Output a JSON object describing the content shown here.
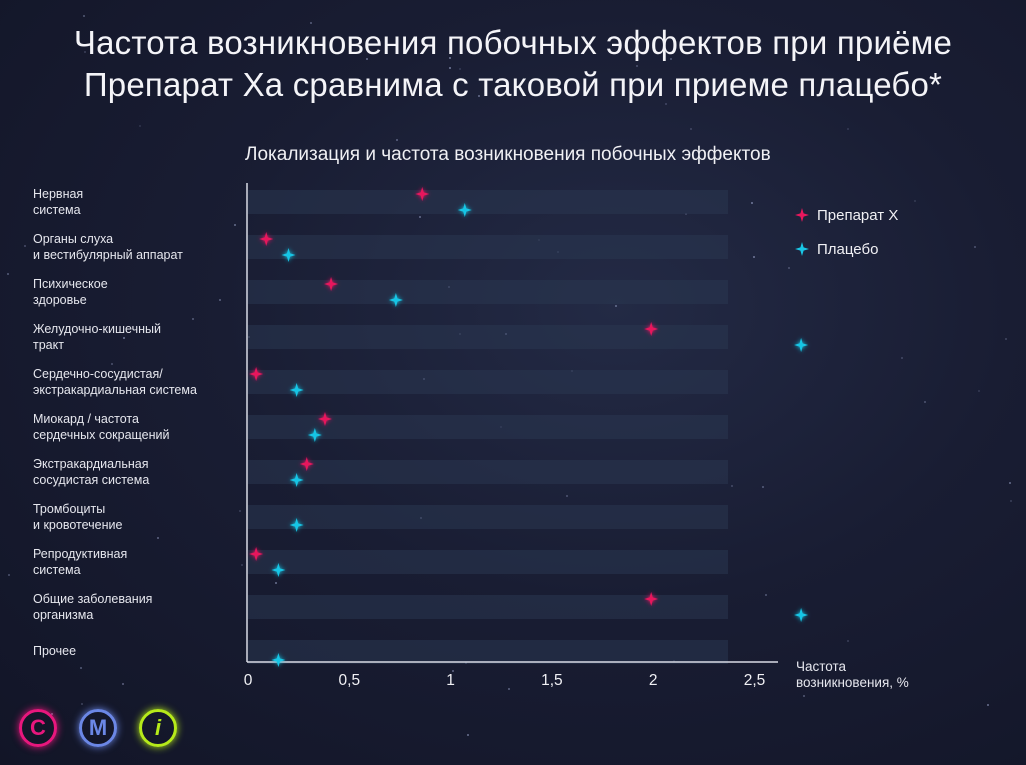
{
  "headline": {
    "line1": "Частота возникновения побочных эффектов при приёме",
    "line2": "Препарат Ха сравнима с таковой при приеме плацебо*"
  },
  "colors": {
    "drug": "#e8175d",
    "placebo": "#19c6e6",
    "background": "#191d33",
    "band": "#2a3650",
    "btn_c": "#e8177d",
    "btn_m": "#6b87e6",
    "btn_i": "#b6ea1a"
  },
  "nav_buttons": [
    {
      "label": "C",
      "icon": "c-circle-icon"
    },
    {
      "label": "M",
      "icon": "m-circle-icon"
    },
    {
      "label": "i",
      "icon": "info-circle-icon"
    }
  ],
  "chart_data": {
    "type": "bar",
    "orientation": "horizontal",
    "marker": "lollipop-star",
    "title": "Локализация и частота возникновения побочных эффектов",
    "xlabel": "Частота\nвозникновения, %",
    "xlim": [
      0,
      2.6
    ],
    "xticks": [
      0,
      0.5,
      1,
      1.5,
      2,
      2.5
    ],
    "xtick_labels": [
      "0",
      "0,5",
      "1",
      "1,5",
      "2",
      "2,5"
    ],
    "legend_position": "top-right",
    "categories": [
      "Нервная\nсистема",
      "Органы слуха\nи вестибулярный аппарат",
      "Психическое\nздоровье",
      "Желудочно-кишечный\nтракт",
      "Сердечно-сосудистая/\nэкстракардиальная система",
      "Миокард / частота\nсердечных сокращений",
      "Экстракардиальная\nсосудистая система",
      "Тромбоциты\nи кровотечение",
      "Репродуктивная\nсистема",
      "Общие заболевания\nорганизма",
      "Прочее"
    ],
    "series": [
      {
        "name": "Препарат X",
        "values": [
          0.86,
          0.09,
          0.41,
          1.99,
          0.04,
          0.38,
          0.29,
          null,
          0.04,
          1.99,
          null
        ]
      },
      {
        "name": "Плацебо",
        "values": [
          1.07,
          0.2,
          0.73,
          2.73,
          0.24,
          0.33,
          0.24,
          0.24,
          0.15,
          2.73,
          0.15
        ]
      }
    ]
  }
}
